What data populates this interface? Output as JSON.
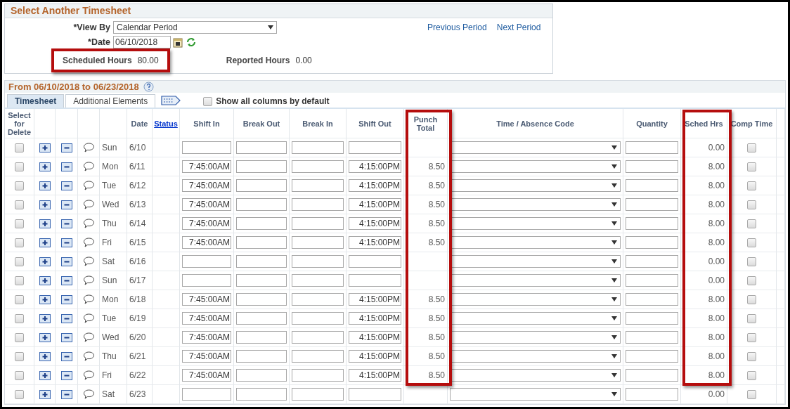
{
  "select_panel": {
    "title": "Select Another Timesheet",
    "view_by": {
      "label": "*View By",
      "value": "Calendar Period"
    },
    "date": {
      "label": "*Date",
      "value": "06/10/2018"
    },
    "links": [
      "Previous Period",
      "Next Period"
    ],
    "scheduled_hours": {
      "label": "Scheduled Hours",
      "value": "80.00",
      "highlighted": true
    },
    "reported_hours": {
      "label": "Reported Hours",
      "value": "0.00"
    }
  },
  "timesheet": {
    "title": "From 06/10/2018 to 06/23/2018",
    "tabs": [
      {
        "label": "Timesheet",
        "selected": true
      },
      {
        "label": "Additional Elements",
        "selected": false
      }
    ],
    "show_all_columns": {
      "label": "Show all columns by default",
      "checked": false
    },
    "columns": [
      {
        "label": "Select for Delete",
        "kind": "text",
        "highlighted": false
      },
      {
        "label": "Date",
        "kind": "text",
        "highlighted": false
      },
      {
        "label": "Status",
        "kind": "link",
        "highlighted": false
      },
      {
        "label": "Shift In",
        "kind": "text",
        "highlighted": false
      },
      {
        "label": "Break Out",
        "kind": "text",
        "highlighted": false
      },
      {
        "label": "Break In",
        "kind": "text",
        "highlighted": false
      },
      {
        "label": "Shift Out",
        "kind": "text",
        "highlighted": false
      },
      {
        "label": "Punch Total",
        "kind": "text",
        "highlighted": true
      },
      {
        "label": "Time / Absence Code",
        "kind": "text",
        "highlighted": false
      },
      {
        "label": "Quantity",
        "kind": "text",
        "highlighted": false
      },
      {
        "label": "Sched Hrs",
        "kind": "text",
        "highlighted": true
      },
      {
        "label": "Comp Time",
        "kind": "text",
        "highlighted": false
      }
    ],
    "rows": [
      {
        "selected": false,
        "day": "Sun",
        "date": "6/10",
        "sched_hrs": "0.00",
        "comp_time": false
      },
      {
        "selected": false,
        "day": "Mon",
        "date": "6/11",
        "shift_in": "7:45:00AM",
        "shift_out": "4:15:00PM",
        "punch_total": "8.50",
        "sched_hrs": "8.00",
        "comp_time": false
      },
      {
        "selected": false,
        "day": "Tue",
        "date": "6/12",
        "shift_in": "7:45:00AM",
        "shift_out": "4:15:00PM",
        "punch_total": "8.50",
        "sched_hrs": "8.00",
        "comp_time": false
      },
      {
        "selected": false,
        "day": "Wed",
        "date": "6/13",
        "shift_in": "7:45:00AM",
        "shift_out": "4:15:00PM",
        "punch_total": "8.50",
        "sched_hrs": "8.00",
        "comp_time": false
      },
      {
        "selected": false,
        "day": "Thu",
        "date": "6/14",
        "shift_in": "7:45:00AM",
        "shift_out": "4:15:00PM",
        "punch_total": "8.50",
        "sched_hrs": "8.00",
        "comp_time": false
      },
      {
        "selected": false,
        "day": "Fri",
        "date": "6/15",
        "shift_in": "7:45:00AM",
        "shift_out": "4:15:00PM",
        "punch_total": "8.50",
        "sched_hrs": "8.00",
        "comp_time": false
      },
      {
        "selected": false,
        "day": "Sat",
        "date": "6/16",
        "sched_hrs": "0.00",
        "comp_time": false
      },
      {
        "selected": false,
        "day": "Sun",
        "date": "6/17",
        "sched_hrs": "0.00",
        "comp_time": false
      },
      {
        "selected": false,
        "day": "Mon",
        "date": "6/18",
        "shift_in": "7:45:00AM",
        "shift_out": "4:15:00PM",
        "punch_total": "8.50",
        "sched_hrs": "8.00",
        "comp_time": false
      },
      {
        "selected": false,
        "day": "Tue",
        "date": "6/19",
        "shift_in": "7:45:00AM",
        "shift_out": "4:15:00PM",
        "punch_total": "8.50",
        "sched_hrs": "8.00",
        "comp_time": false
      },
      {
        "selected": false,
        "day": "Wed",
        "date": "6/20",
        "shift_in": "7:45:00AM",
        "shift_out": "4:15:00PM",
        "punch_total": "8.50",
        "sched_hrs": "8.00",
        "comp_time": false
      },
      {
        "selected": false,
        "day": "Thu",
        "date": "6/21",
        "shift_in": "7:45:00AM",
        "shift_out": "4:15:00PM",
        "punch_total": "8.50",
        "sched_hrs": "8.00",
        "comp_time": false
      },
      {
        "selected": false,
        "day": "Fri",
        "date": "6/22",
        "shift_in": "7:45:00AM",
        "shift_out": "4:15:00PM",
        "punch_total": "8.50",
        "sched_hrs": "8.00",
        "comp_time": false
      },
      {
        "selected": false,
        "day": "Sat",
        "date": "6/23",
        "sched_hrs": "0.00",
        "comp_time": false
      }
    ]
  }
}
